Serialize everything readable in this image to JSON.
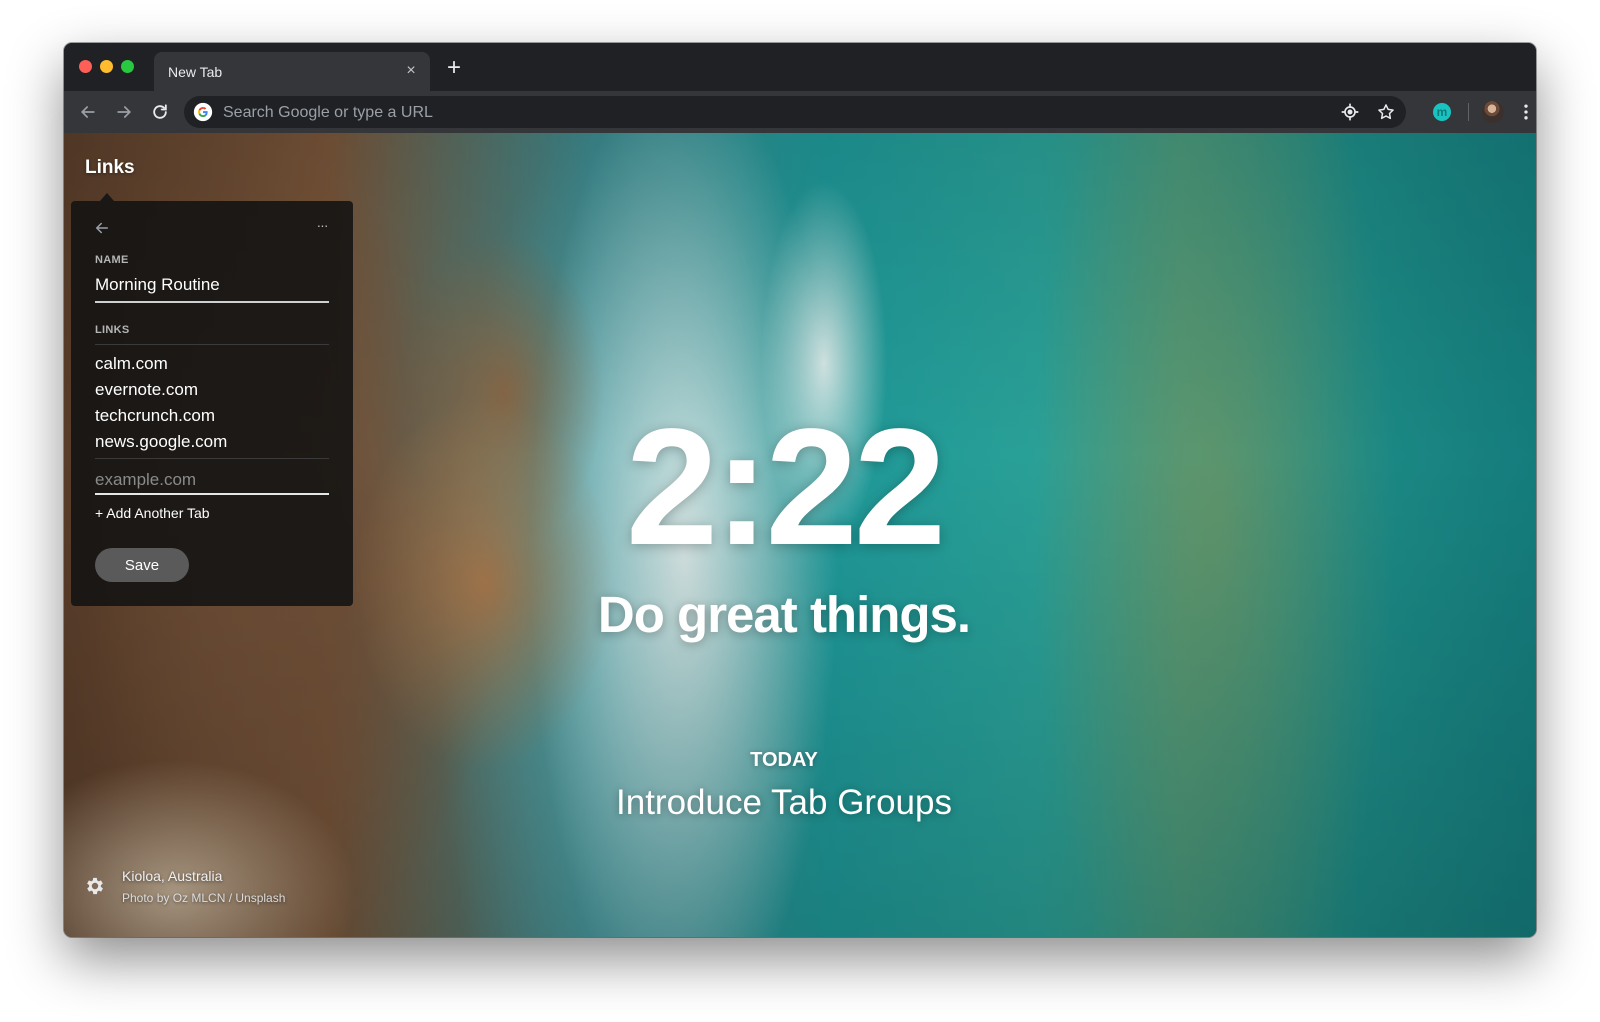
{
  "browser": {
    "tab": {
      "title": "New Tab",
      "close_glyph": "×"
    },
    "new_tab_glyph": "+",
    "omnibox": {
      "placeholder": "Search Google or type a URL"
    },
    "extension_badge": "m",
    "more_glyph": "⋮"
  },
  "links_panel": {
    "title": "Links",
    "more_glyph": "···",
    "name_label": "NAME",
    "name_value": "Morning Routine",
    "links_label": "LINKS",
    "links": [
      "calm.com",
      "evernote.com",
      "techcrunch.com",
      "news.google.com"
    ],
    "input_placeholder": "example.com",
    "add_another": "+ Add Another Tab",
    "save_label": "Save"
  },
  "dashboard": {
    "time": "2:22",
    "greeting": "Do great things.",
    "focus_label": "TODAY",
    "focus_text": "Introduce Tab Groups"
  },
  "footer": {
    "location": "Kioloa, Australia",
    "credit": "Photo by Oz MLCN / Unsplash"
  },
  "colors": {
    "titlebar": "#202124",
    "toolbar": "#35363a",
    "accent_teal": "#19c3c0"
  },
  "icons": [
    "back-icon",
    "forward-icon",
    "reload-icon",
    "google-icon",
    "location-target-icon",
    "star-icon",
    "extension-m-icon",
    "avatar",
    "more-vert-icon",
    "arrow-left-icon",
    "more-horiz-icon",
    "gear-icon"
  ]
}
